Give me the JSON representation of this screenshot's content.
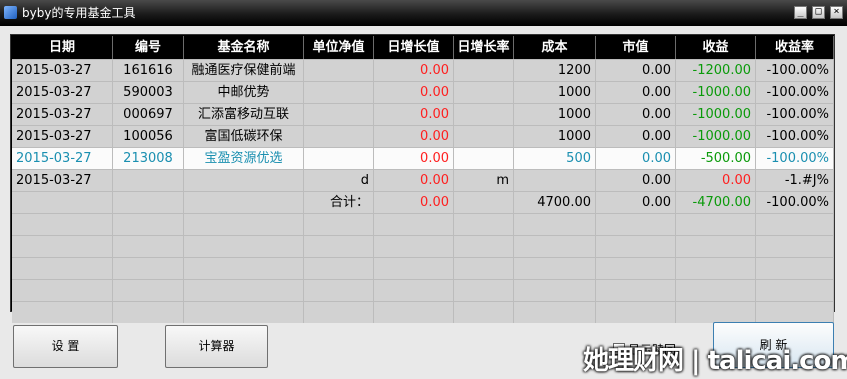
{
  "window": {
    "title": "byby的专用基金工具"
  },
  "table": {
    "columns": [
      "日期",
      "编号",
      "基金名称",
      "单位净值",
      "日增长值",
      "日增长率",
      "成本",
      "市值",
      "收益",
      "收益率"
    ],
    "rows": [
      {
        "date": "2015-03-27",
        "code": "161616",
        "name": "融通医疗保健前端",
        "nav": "",
        "chg": "0.00",
        "pct": "",
        "cost": "1200",
        "value": "0.00",
        "profit": "-1200.00",
        "rate": "-100.00%"
      },
      {
        "date": "2015-03-27",
        "code": "590003",
        "name": "中邮优势",
        "nav": "",
        "chg": "0.00",
        "pct": "",
        "cost": "1000",
        "value": "0.00",
        "profit": "-1000.00",
        "rate": "-100.00%"
      },
      {
        "date": "2015-03-27",
        "code": "000697",
        "name": "汇添富移动互联",
        "nav": "",
        "chg": "0.00",
        "pct": "",
        "cost": "1000",
        "value": "0.00",
        "profit": "-1000.00",
        "rate": "-100.00%"
      },
      {
        "date": "2015-03-27",
        "code": "100056",
        "name": "富国低碳环保",
        "nav": "",
        "chg": "0.00",
        "pct": "",
        "cost": "1000",
        "value": "0.00",
        "profit": "-1000.00",
        "rate": "-100.00%"
      },
      {
        "date": "2015-03-27",
        "code": "213008",
        "name": "宝盈资源优选",
        "nav": "",
        "chg": "0.00",
        "pct": "",
        "cost": "500",
        "value": "0.00",
        "profit": "-500.00",
        "rate": "-100.00%"
      },
      {
        "date": "2015-03-27",
        "code": "",
        "name": "",
        "nav": "d",
        "chg": "0.00",
        "pct": "m",
        "cost": "",
        "value": "0.00",
        "profit": "0.00",
        "rate": "-1.#J%"
      },
      {
        "date": "",
        "code": "",
        "name": "",
        "nav": "合计：",
        "chg": "0.00",
        "pct": "",
        "cost": "4700.00",
        "value": "0.00",
        "profit": "-4700.00",
        "rate": "-100.00%"
      },
      {
        "date": "",
        "code": "",
        "name": "",
        "nav": "",
        "chg": "",
        "pct": "",
        "cost": "",
        "value": "",
        "profit": "",
        "rate": ""
      },
      {
        "date": "",
        "code": "",
        "name": "",
        "nav": "",
        "chg": "",
        "pct": "",
        "cost": "",
        "value": "",
        "profit": "",
        "rate": ""
      },
      {
        "date": "",
        "code": "",
        "name": "",
        "nav": "",
        "chg": "",
        "pct": "",
        "cost": "",
        "value": "",
        "profit": "",
        "rate": ""
      },
      {
        "date": "",
        "code": "",
        "name": "",
        "nav": "",
        "chg": "",
        "pct": "",
        "cost": "",
        "value": "",
        "profit": "",
        "rate": ""
      },
      {
        "date": "",
        "code": "",
        "name": "",
        "nav": "",
        "chg": "",
        "pct": "",
        "cost": "",
        "value": "",
        "profit": "",
        "rate": ""
      }
    ],
    "selected_row": 4
  },
  "buttons": {
    "settings": "设  置",
    "calculator": "计算器",
    "refresh": "刷  新"
  },
  "checkbox": {
    "label": "显示赎回"
  },
  "watermark": "她理财网 | talicai.com",
  "colors": {
    "gain_negative": "#0a9a0a",
    "change": "#ff1f1f",
    "selected_text": "#1a8fb0"
  }
}
